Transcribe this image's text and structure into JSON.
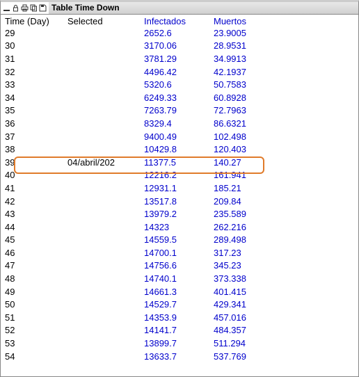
{
  "window": {
    "title": "Table Time Down"
  },
  "headers": {
    "time": "Time (Day)",
    "selected": "Selected",
    "infectados": "Infectados",
    "muertos": "Muertos"
  },
  "rows": [
    {
      "t": "29",
      "sel": "",
      "inf": "2652.6",
      "mue": "23.9005"
    },
    {
      "t": "30",
      "sel": "",
      "inf": "3170.06",
      "mue": "28.9531"
    },
    {
      "t": "31",
      "sel": "",
      "inf": "3781.29",
      "mue": "34.9913"
    },
    {
      "t": "32",
      "sel": "",
      "inf": "4496.42",
      "mue": "42.1937"
    },
    {
      "t": "33",
      "sel": "",
      "inf": "5320.6",
      "mue": "50.7583"
    },
    {
      "t": "34",
      "sel": "",
      "inf": "6249.33",
      "mue": "60.8928"
    },
    {
      "t": "35",
      "sel": "",
      "inf": "7263.79",
      "mue": "72.7963"
    },
    {
      "t": "36",
      "sel": "",
      "inf": "8329.4",
      "mue": "86.6321"
    },
    {
      "t": "37",
      "sel": "",
      "inf": "9400.49",
      "mue": "102.498"
    },
    {
      "t": "38",
      "sel": "",
      "inf": "10429.8",
      "mue": "120.403"
    },
    {
      "t": "39",
      "sel": "04/abril/202",
      "inf": "11377.5",
      "mue": "140.27"
    },
    {
      "t": "40",
      "sel": "",
      "inf": "12216.2",
      "mue": "161.941"
    },
    {
      "t": "41",
      "sel": "",
      "inf": "12931.1",
      "mue": "185.21"
    },
    {
      "t": "42",
      "sel": "",
      "inf": "13517.8",
      "mue": "209.84"
    },
    {
      "t": "43",
      "sel": "",
      "inf": "13979.2",
      "mue": "235.589"
    },
    {
      "t": "44",
      "sel": "",
      "inf": "14323",
      "mue": "262.216"
    },
    {
      "t": "45",
      "sel": "",
      "inf": "14559.5",
      "mue": "289.498"
    },
    {
      "t": "46",
      "sel": "",
      "inf": "14700.1",
      "mue": "317.23"
    },
    {
      "t": "47",
      "sel": "",
      "inf": "14756.6",
      "mue": "345.23"
    },
    {
      "t": "48",
      "sel": "",
      "inf": "14740.1",
      "mue": "373.338"
    },
    {
      "t": "49",
      "sel": "",
      "inf": "14661.3",
      "mue": "401.415"
    },
    {
      "t": "50",
      "sel": "",
      "inf": "14529.7",
      "mue": "429.341"
    },
    {
      "t": "51",
      "sel": "",
      "inf": "14353.9",
      "mue": "457.016"
    },
    {
      "t": "52",
      "sel": "",
      "inf": "14141.7",
      "mue": "484.357"
    },
    {
      "t": "53",
      "sel": "",
      "inf": "13899.7",
      "mue": "511.294"
    },
    {
      "t": "54",
      "sel": "",
      "inf": "13633.7",
      "mue": "537.769"
    }
  ],
  "highlight_index": 10,
  "chart_data": {
    "type": "table",
    "title": "Table Time Down",
    "columns": [
      "Time (Day)",
      "Selected",
      "Infectados",
      "Muertos"
    ],
    "x": [
      29,
      30,
      31,
      32,
      33,
      34,
      35,
      36,
      37,
      38,
      39,
      40,
      41,
      42,
      43,
      44,
      45,
      46,
      47,
      48,
      49,
      50,
      51,
      52,
      53,
      54
    ],
    "series": [
      {
        "name": "Infectados",
        "values": [
          2652.6,
          3170.06,
          3781.29,
          4496.42,
          5320.6,
          6249.33,
          7263.79,
          8329.4,
          9400.49,
          10429.8,
          11377.5,
          12216.2,
          12931.1,
          13517.8,
          13979.2,
          14323,
          14559.5,
          14700.1,
          14756.6,
          14740.1,
          14661.3,
          14529.7,
          14353.9,
          14141.7,
          13899.7,
          13633.7
        ]
      },
      {
        "name": "Muertos",
        "values": [
          23.9005,
          28.9531,
          34.9913,
          42.1937,
          50.7583,
          60.8928,
          72.7963,
          86.6321,
          102.498,
          120.403,
          140.27,
          161.941,
          185.21,
          209.84,
          235.589,
          262.216,
          289.498,
          317.23,
          345.23,
          373.338,
          401.415,
          429.341,
          457.016,
          484.357,
          511.294,
          537.769
        ]
      }
    ]
  }
}
